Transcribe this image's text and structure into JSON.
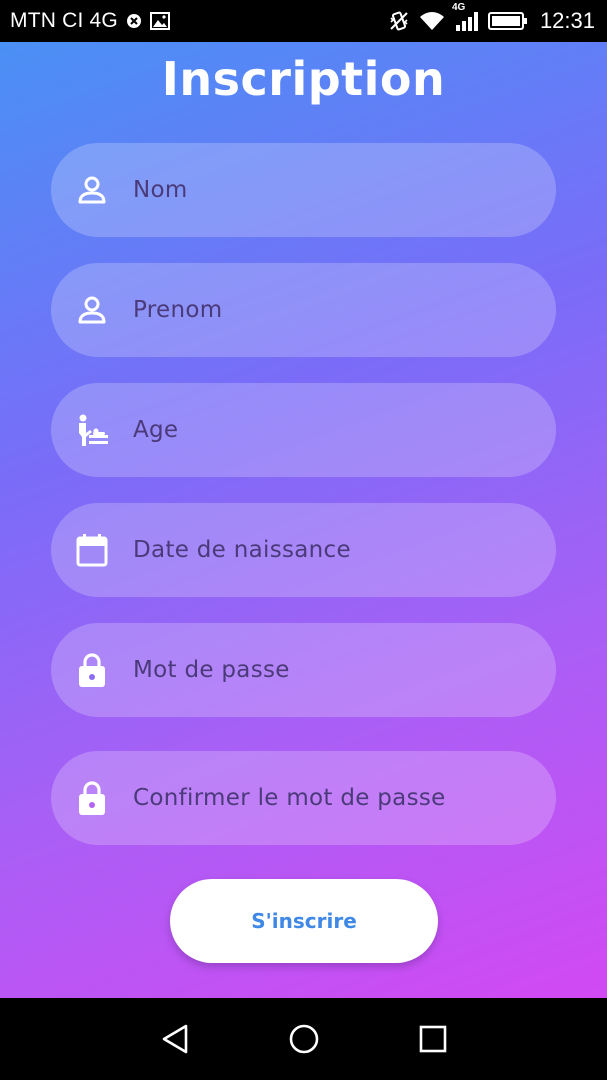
{
  "status_bar": {
    "carrier": "MTN CI 4G",
    "network_type": "4G",
    "time": "12:31",
    "icons": [
      "close-circle-icon",
      "image-icon",
      "vibrate-icon",
      "wifi-icon",
      "signal-icon",
      "battery-icon"
    ]
  },
  "page": {
    "title": "Inscription"
  },
  "form": {
    "fields": [
      {
        "placeholder": "Nom",
        "icon": "person-icon"
      },
      {
        "placeholder": "Prenom",
        "icon": "person-icon"
      },
      {
        "placeholder": "Age",
        "icon": "baby-changing-icon"
      },
      {
        "placeholder": "Date de naissance",
        "icon": "calendar-icon"
      },
      {
        "placeholder": "Mot de passe",
        "icon": "lock-icon"
      },
      {
        "placeholder": "Confirmer le mot de passe",
        "icon": "lock-icon"
      }
    ],
    "submit_label": "S'inscrire"
  },
  "nav_bar": {
    "buttons": [
      "back-icon",
      "home-icon",
      "recents-icon"
    ]
  },
  "colors": {
    "gradient_start": "#4a90f5",
    "gradient_end": "#d249f4",
    "placeholder_text": "#4b3a7a",
    "button_text": "#3f88e6"
  }
}
